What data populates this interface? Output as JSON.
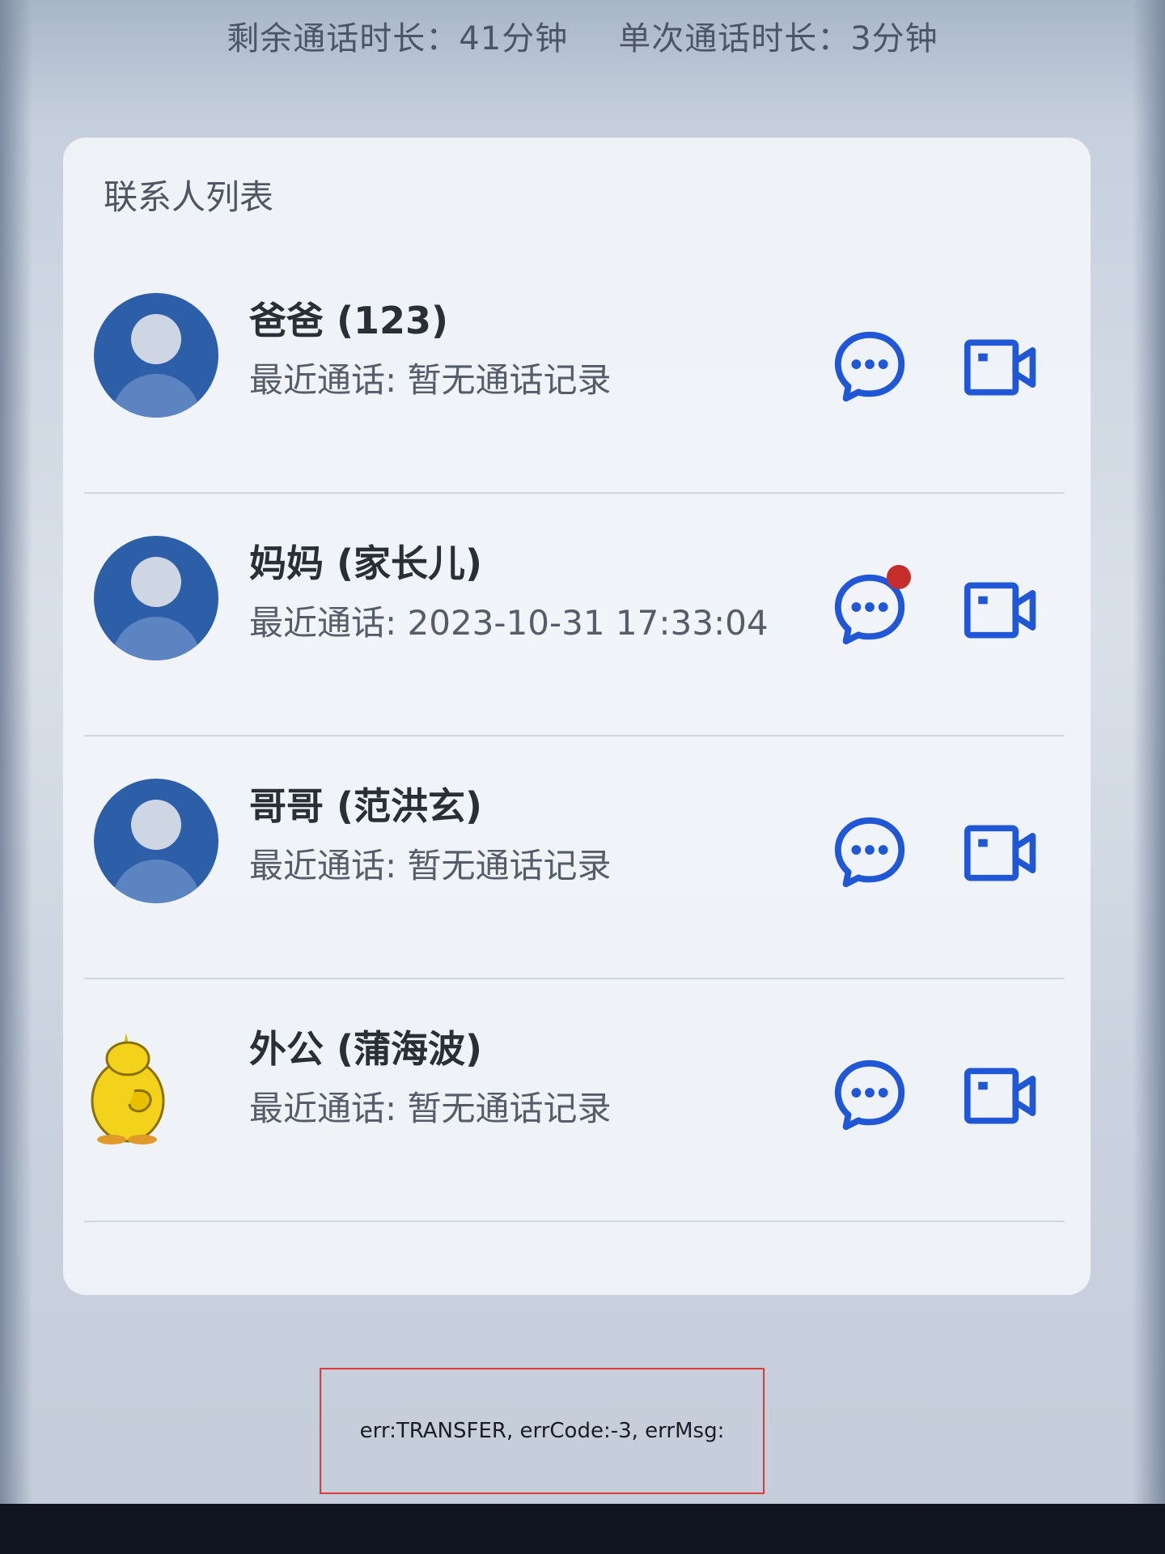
{
  "header": {
    "remaining_time": "剩余通话时长：41分钟",
    "single_call_time": "单次通话时长：3分钟"
  },
  "contacts_card": {
    "title": "联系人列表",
    "contacts": [
      {
        "name": "爸爸 (123)",
        "recent": "最近通话: 暂无通话记录",
        "avatar": "default-person-icon",
        "unread": false
      },
      {
        "name": "妈妈 (家长儿)",
        "recent": "最近通话: 2023-10-31 17:33:04",
        "avatar": "default-person-icon",
        "unread": true
      },
      {
        "name": "哥哥 (范洪玄)",
        "recent": "最近通话: 暂无通话记录",
        "avatar": "default-person-icon",
        "unread": false
      },
      {
        "name": "外公 (蒲海波)",
        "recent": "最近通话: 暂无通话记录",
        "avatar": "yellow-duck-avatar",
        "unread": false
      }
    ]
  },
  "icons": {
    "chat": "chat-bubble-icon",
    "video": "video-camera-icon"
  },
  "colors": {
    "accent": "#1f57d6",
    "avatar_bg": "#2d5fa8",
    "unread_badge": "#c52c2c",
    "error_border": "#e03a3a"
  },
  "error_toast": {
    "message": "err:TRANSFER, errCode:-3, errMsg:"
  }
}
